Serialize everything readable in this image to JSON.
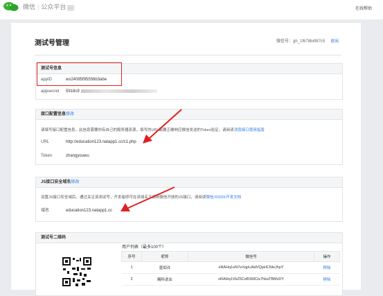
{
  "header": {
    "brand_name": "微信",
    "brand_sub": "公众平台",
    "right_text": "在线帮助"
  },
  "page": {
    "title": "测试号管理",
    "account_label": "微信号：gh_1f678b4f67c5",
    "logout_label": "退出"
  },
  "test_info": {
    "title": "测试号信息",
    "appid_label": "appID",
    "appid_value": "wx24085f95556b3abe",
    "appsecret_label": "appsecret",
    "appsecret_value": "5918c9"
  },
  "interface_config": {
    "title": "接口配置信息",
    "edit_link": "修改",
    "note": "请填写接口配置信息，此信息需要你有自己的服务器资源，填写的URL需要正确响应微信发送的Token验证，请阅读",
    "note_link": "消息接口使用指南",
    "url_label": "URL",
    "url_value": "http://education123.natapp1.cc/c1.php",
    "token_label": "Token",
    "token_value": "zhangyouwu"
  },
  "js_domain": {
    "title": "JS接口安全域名",
    "edit_link": "修改",
    "note": "设置JS接口安全域后，通过关注该测试号，开发者即可在该域名下调用微信开放的JS接口，请阅读",
    "note_link": "微信JSSDK开发文档",
    "domain_label": "域名",
    "domain_value": "education123.natapp1.cc"
  },
  "qr_section": {
    "title": "测试号二维码",
    "user_list_title": "用户列表（最多100个）",
    "columns": [
      "序号",
      "昵称",
      "微信号",
      "操作"
    ],
    "rows": [
      {
        "index": "1",
        "nickname": "墨如许",
        "wechat_id": "oRAHq1eN7eXqpUAdVQpHCNleJhpY",
        "action": "移除"
      },
      {
        "index": "2",
        "nickname": "赐科说业",
        "wechat_id": "oRAHq1VbZ5CeBSMCtz7hkaTBMvDY",
        "action": "移除"
      }
    ]
  },
  "colors": {
    "accent": "#2d7be5",
    "highlight": "#e02020",
    "background": "#e9ebee"
  }
}
